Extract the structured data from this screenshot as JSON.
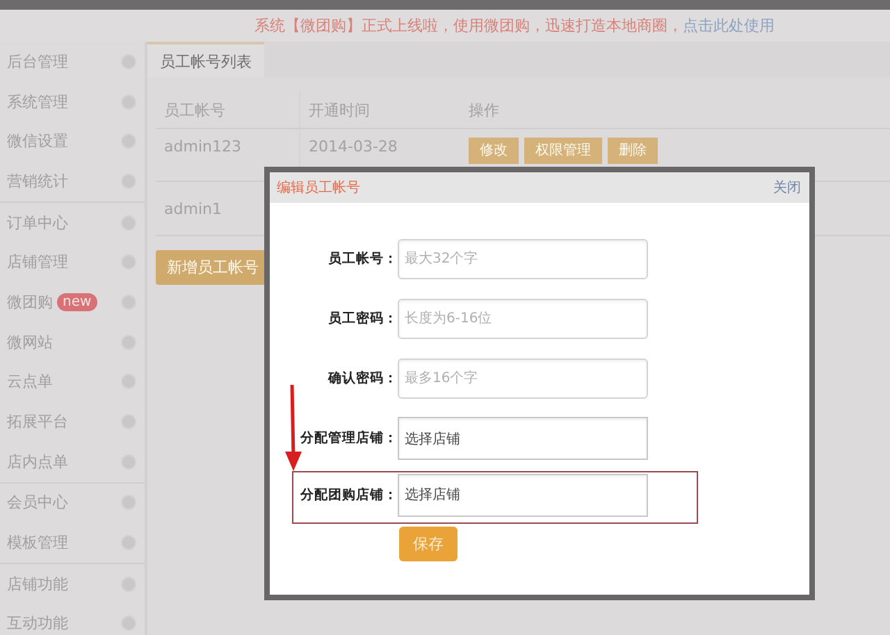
{
  "banner": {
    "text": "系统【微团购】正式上线啦，使用微团购，迅速打造本地商圈，",
    "link": "点击此处使用"
  },
  "sidebar": {
    "groups": [
      {
        "items": [
          {
            "label": "后台管理"
          },
          {
            "label": "系统管理"
          },
          {
            "label": "微信设置"
          },
          {
            "label": "营销统计"
          }
        ]
      },
      {
        "items": [
          {
            "label": "订单中心"
          },
          {
            "label": "店铺管理"
          },
          {
            "label": "微团购",
            "badge": "new"
          },
          {
            "label": "微网站"
          },
          {
            "label": "云点单"
          },
          {
            "label": "拓展平台"
          },
          {
            "label": "店内点单"
          }
        ]
      },
      {
        "items": [
          {
            "label": "会员中心"
          },
          {
            "label": "模板管理"
          }
        ]
      },
      {
        "items": [
          {
            "label": "店铺功能"
          },
          {
            "label": "互动功能"
          }
        ]
      }
    ]
  },
  "tabs": [
    {
      "label": "员工帐号列表",
      "selected": true
    }
  ],
  "table": {
    "columns": [
      "员工帐号",
      "开通时间",
      "操作"
    ],
    "rows": [
      {
        "cells": [
          "admin123",
          "2014-03-28"
        ],
        "actions": [
          "修改",
          "权限管理",
          "删除"
        ]
      },
      {
        "cells": [
          "admin1"
        ],
        "actions": []
      }
    ]
  },
  "add_button": "新增员工帐号",
  "dialog": {
    "title": "编辑员工帐号",
    "close": "关闭",
    "fields": [
      {
        "label": "员工帐号：",
        "placeholder": "最大32个字",
        "highlighted": false
      },
      {
        "label": "员工密码：",
        "placeholder": "长度为6-16位",
        "highlighted": false
      },
      {
        "label": "确认密码：",
        "placeholder": "最多16个字",
        "highlighted": false
      },
      {
        "label": "分配管理店铺：",
        "value": "选择店铺",
        "highlighted": false
      },
      {
        "label": "分配团购店铺：",
        "value": "选择店铺",
        "highlighted": true
      }
    ],
    "save": "保存"
  }
}
